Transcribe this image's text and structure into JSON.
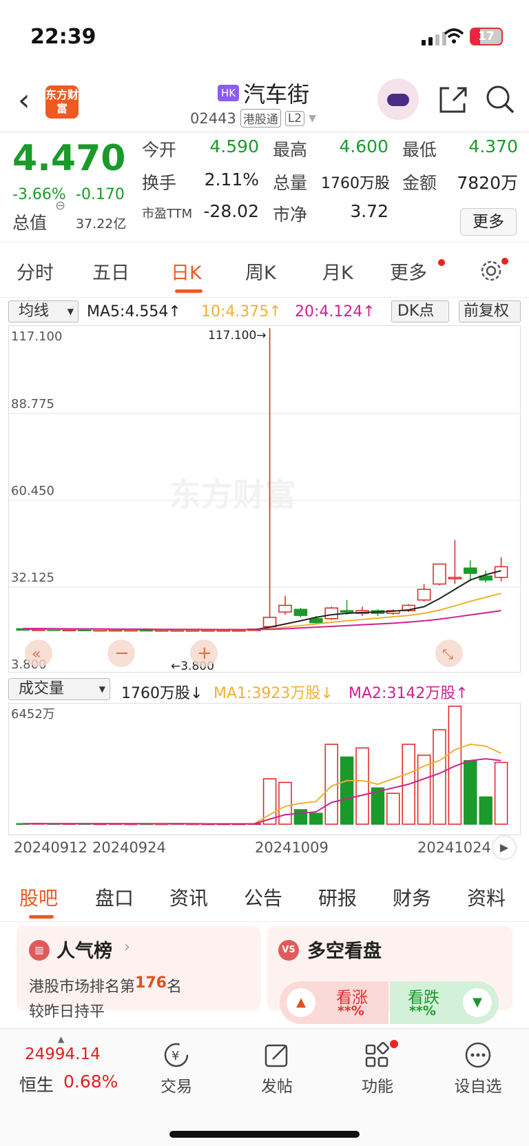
{
  "status": {
    "time": "22:39",
    "battery": "17"
  },
  "header": {
    "badge": "HK",
    "name": "汽车街",
    "code": "02443",
    "tag1": "港股通",
    "tag2": "L2",
    "logo": "东方财富"
  },
  "quote": {
    "price": "4.470",
    "pct": "-3.66%",
    "chg": "-0.170",
    "total_label": "总值",
    "total_value": "37.22亿",
    "fields": [
      {
        "label": "今开",
        "value": "4.590"
      },
      {
        "label": "最高",
        "value": "4.600"
      },
      {
        "label": "最低",
        "value": "4.370"
      },
      {
        "label": "换手",
        "value": "2.11%"
      },
      {
        "label": "总量",
        "value": "1760万股"
      },
      {
        "label": "金额",
        "value": "7820万"
      },
      {
        "label": "市盈TTM",
        "value": "-28.02"
      },
      {
        "label": "市净",
        "value": "3.72"
      }
    ],
    "more": "更多"
  },
  "tabs": [
    "分时",
    "五日",
    "日K",
    "周K",
    "月K",
    "更多"
  ],
  "ma": {
    "select": "均线",
    "ma5": "MA5:4.554↑",
    "ma10": "10:4.375↑",
    "ma20": "20:4.124↑",
    "dk": "DK点",
    "fq": "前复权"
  },
  "chart_labels": {
    "y1": "117.100",
    "y2": "88.775",
    "y3": "60.450",
    "y4": "32.125",
    "y5": "3.800",
    "high": "117.100→",
    "low": "←3.800",
    "watermark": "东方财富"
  },
  "vol": {
    "select": "成交量",
    "v": "1760万股↓",
    "ma1": "MA1:3923万股↓",
    "ma2": "MA2:3142万股↑",
    "max": "6452万"
  },
  "x_labels": [
    "20240912",
    "20240924",
    "20241009",
    "20241024"
  ],
  "sections": [
    "股吧",
    "盘口",
    "资讯",
    "公告",
    "研报",
    "财务",
    "资料"
  ],
  "cards": {
    "rank_title": "人气榜",
    "rank_text1": "港股市场排名第",
    "rank_num": "176",
    "rank_text2": "名",
    "rank_text3": "较昨日持平",
    "ls_title": "多空看盘",
    "up": "看涨",
    "up_v": "**%",
    "down": "看跌",
    "down_v": "**%"
  },
  "bottom": {
    "index_value": "24994.14",
    "index_name": "恒生",
    "index_pct": "0.68%",
    "items": [
      "交易",
      "发帖",
      "功能",
      "设自选"
    ]
  },
  "chart_data": {
    "type": "candlestick",
    "y_ticks": [
      117.1,
      88.775,
      60.45,
      32.125,
      3.8
    ],
    "ylim": [
      3.8,
      117.1
    ],
    "candles": [
      [
        4.2,
        4.0,
        4.3,
        3.9
      ],
      [
        4.0,
        4.1,
        4.2,
        3.9
      ],
      [
        4.1,
        4.0,
        4.2,
        3.9
      ],
      [
        4.0,
        4.0,
        4.1,
        3.9
      ],
      [
        4.0,
        3.9,
        4.1,
        3.85
      ],
      [
        3.9,
        3.9,
        4.0,
        3.8
      ],
      [
        3.9,
        3.9,
        4.0,
        3.8
      ],
      [
        3.9,
        3.9,
        3.95,
        3.8
      ],
      [
        3.9,
        3.85,
        3.95,
        3.8
      ],
      [
        3.85,
        3.85,
        3.9,
        3.8
      ],
      [
        3.85,
        3.85,
        3.9,
        3.8
      ],
      [
        3.85,
        3.85,
        3.9,
        3.8
      ],
      [
        3.85,
        3.85,
        3.9,
        3.8
      ],
      [
        3.85,
        3.85,
        3.9,
        3.8
      ],
      [
        3.85,
        3.85,
        3.9,
        3.8
      ],
      [
        4.0,
        4.1,
        4.2,
        3.9
      ],
      [
        5.0,
        8.5,
        117.1,
        4.8
      ],
      [
        10.5,
        13.0,
        16.5,
        9.5
      ],
      [
        11.5,
        9.2,
        12.0,
        8.5
      ],
      [
        8.0,
        6.5,
        9.0,
        6.0
      ],
      [
        8.0,
        12.0,
        12.5,
        7.5
      ],
      [
        11.0,
        10.5,
        15.0,
        9.5
      ],
      [
        10.0,
        11.0,
        12.5,
        9.0
      ],
      [
        11.0,
        10.0,
        11.5,
        9.0
      ],
      [
        10.0,
        11.0,
        11.5,
        9.5
      ],
      [
        11.0,
        13.0,
        13.5,
        10.5
      ],
      [
        15.0,
        19.0,
        21.0,
        14.5
      ],
      [
        21.0,
        28.5,
        28.5,
        20.5
      ],
      [
        23.5,
        23.5,
        37.5,
        21.0
      ],
      [
        27.0,
        25.0,
        30.0,
        22.0
      ],
      [
        24.0,
        22.5,
        26.0,
        21.5
      ],
      [
        23.5,
        27.5,
        31.0,
        22.0
      ]
    ],
    "ma5": [
      4.1,
      4.05,
      4.05,
      4.0,
      4.0,
      3.95,
      3.9,
      3.9,
      3.88,
      3.87,
      3.86,
      3.85,
      3.85,
      3.85,
      3.85,
      3.9,
      4.8,
      6.0,
      7.2,
      8.5,
      9.5,
      10.0,
      10.3,
      10.5,
      10.8,
      11.3,
      12.5,
      15.5,
      19.0,
      22.5,
      24.5,
      26.0
    ],
    "ma10": [
      4.2,
      4.15,
      4.1,
      4.1,
      4.05,
      4.0,
      4.0,
      3.95,
      3.95,
      3.92,
      3.9,
      3.88,
      3.87,
      3.86,
      3.86,
      3.87,
      4.2,
      4.8,
      5.4,
      6.0,
      6.6,
      7.2,
      7.7,
      8.2,
      8.7,
      9.2,
      10.0,
      11.2,
      12.8,
      14.5,
      16.0,
      17.5
    ],
    "ma20": [
      4.3,
      4.3,
      4.25,
      4.2,
      4.2,
      4.15,
      4.1,
      4.1,
      4.05,
      4.0,
      4.0,
      3.98,
      3.95,
      3.93,
      3.92,
      3.92,
      4.0,
      4.2,
      4.5,
      4.8,
      5.1,
      5.4,
      5.7,
      6.0,
      6.3,
      6.7,
      7.2,
      7.8,
      8.6,
      9.4,
      10.2,
      11.0
    ],
    "volume": [
      0.3,
      0.4,
      0.3,
      0.3,
      0.3,
      0.2,
      0.3,
      0.2,
      0.2,
      0.2,
      0.3,
      0.2,
      0.2,
      0.2,
      0.2,
      0.3,
      25,
      23,
      8,
      6,
      44,
      37,
      42,
      20,
      17,
      44,
      38,
      52,
      65,
      35,
      15,
      34
    ],
    "vol_ma1": [
      0.3,
      0.3,
      0.3,
      0.3,
      0.3,
      0.3,
      0.3,
      0.3,
      0.2,
      0.2,
      0.2,
      0.2,
      0.2,
      0.2,
      0.2,
      0.2,
      5.2,
      9.8,
      11.5,
      12.5,
      21,
      24,
      24,
      22,
      25,
      28,
      32,
      35,
      41,
      44,
      43,
      39
    ],
    "vol_ma2": [
      0.3,
      0.3,
      0.3,
      0.3,
      0.3,
      0.3,
      0.3,
      0.3,
      0.3,
      0.3,
      0.3,
      0.3,
      0.2,
      0.2,
      0.2,
      0.2,
      2.8,
      5.2,
      6.0,
      6.8,
      12,
      14,
      16,
      18,
      20,
      22,
      25,
      28,
      32,
      35,
      36,
      35
    ],
    "vol_max": 64.52,
    "up_color": "#e02020",
    "down_color": "#1a9a2a"
  }
}
